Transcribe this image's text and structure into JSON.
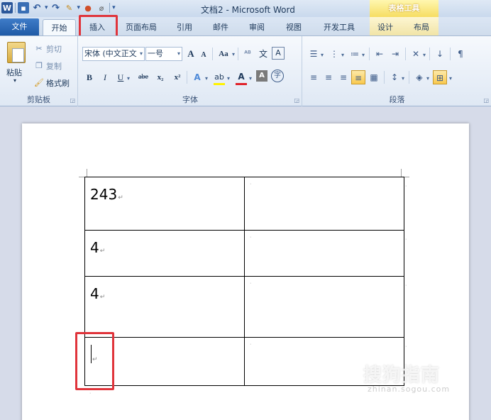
{
  "window": {
    "title": "文档2 - Microsoft Word",
    "context_group": "表格工具"
  },
  "quick_access": {
    "app_icon": "W",
    "icons": [
      "word-icon",
      "save-icon",
      "undo-icon",
      "redo-icon",
      "format-painter-icon",
      "color-icon",
      "eraser-icon"
    ]
  },
  "tabs": [
    {
      "label": "文件"
    },
    {
      "label": "开始"
    },
    {
      "label": "插入"
    },
    {
      "label": "页面布局"
    },
    {
      "label": "引用"
    },
    {
      "label": "邮件"
    },
    {
      "label": "审阅"
    },
    {
      "label": "视图"
    },
    {
      "label": "开发工具"
    },
    {
      "label": "设计"
    },
    {
      "label": "布局"
    }
  ],
  "ribbon": {
    "clipboard": {
      "label": "剪贴板",
      "paste": "粘贴",
      "cut": "剪切",
      "copy": "复制",
      "format_painter": "格式刷"
    },
    "font": {
      "label": "字体",
      "font_name": "宋体 (中文正文",
      "font_size": "一号",
      "grow": "A",
      "shrink": "A",
      "change_case": "Aa",
      "bold": "B",
      "italic": "I",
      "underline": "U",
      "strike": "abe",
      "subscript": "x₂",
      "superscript": "x²",
      "highlight_color": "#fff200",
      "font_color": "#e0232a"
    },
    "paragraph": {
      "label": "段落"
    }
  },
  "document": {
    "rows": [
      {
        "cell1": "243",
        "cell2": ""
      },
      {
        "cell1": "4",
        "cell2": ""
      },
      {
        "cell1": "4",
        "cell2": ""
      },
      {
        "cell1": "",
        "cell2": ""
      }
    ],
    "paragraph_mark": "↵",
    "cell_mark": "¤"
  },
  "watermark": {
    "text": "搜狗指南",
    "sub": "zhinan.sogou.com"
  }
}
